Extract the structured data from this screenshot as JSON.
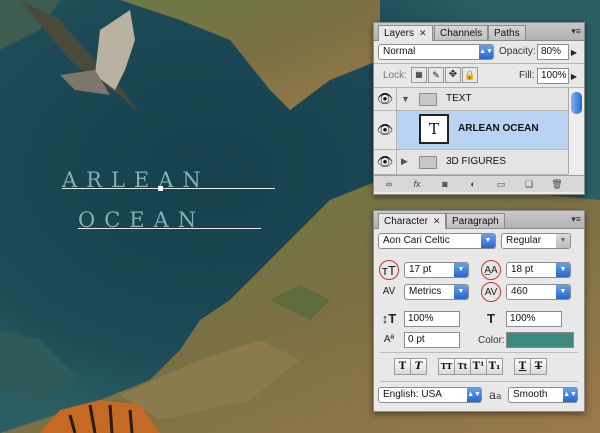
{
  "canvas": {
    "text_line1": "arlean",
    "text_line2": "ocean"
  },
  "layers_panel": {
    "tabs": [
      "Layers",
      "Channels",
      "Paths"
    ],
    "blend_mode": "Normal",
    "opacity_label": "Opacity:",
    "opacity_value": "80%",
    "lock_label": "Lock:",
    "fill_label": "Fill:",
    "fill_value": "100%",
    "layers": [
      {
        "name": "TEXT",
        "type": "group",
        "expanded": true
      },
      {
        "name": "ARLEAN OCEAN",
        "type": "text",
        "thumb": "T",
        "selected": true
      },
      {
        "name": "3D FIGURES",
        "type": "group",
        "expanded": false
      }
    ]
  },
  "character_panel": {
    "tabs": [
      "Character",
      "Paragraph"
    ],
    "font_family": "Aon Cari Celtic",
    "font_style": "Regular",
    "font_size": "17 pt",
    "leading": "18 pt",
    "kerning": "Metrics",
    "tracking": "460",
    "vertical_scale": "100%",
    "horizontal_scale": "100%",
    "baseline_shift": "0 pt",
    "color_label": "Color:",
    "color_value": "#3f8a80",
    "language": "English: USA",
    "antialias_label": "a",
    "antialias": "Smooth",
    "style_buttons": [
      "T",
      "T",
      "TT",
      "Tt",
      "T¹",
      "T₁",
      "T",
      "T"
    ]
  }
}
